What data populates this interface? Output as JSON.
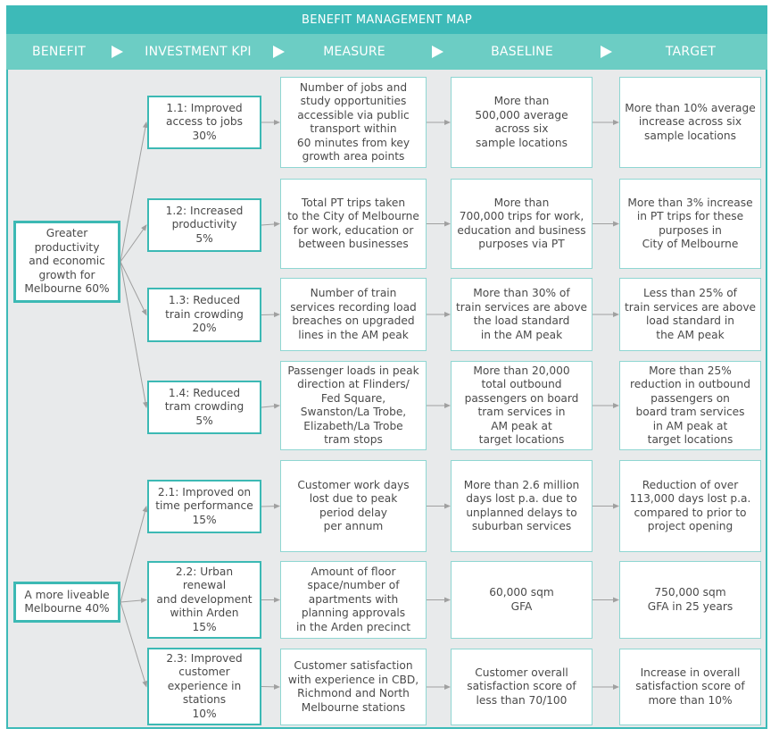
{
  "title": "BENEFIT MANAGEMENT MAP",
  "columns": [
    "BENEFIT",
    "INVESTMENT KPI",
    "MEASURE",
    "BASELINE",
    "TARGET"
  ],
  "icons": {
    "column_separator": "play-arrow-icon",
    "connector": "arrow-right-icon"
  },
  "colors": {
    "title_band": "#3dbab8",
    "header_row": "#6ccdc4",
    "body": "#e8eaeb",
    "box_border_strong": "#3cb9b4",
    "box_border_light": "#8fd6d2",
    "connector": "#a0a0a0"
  },
  "benefits": [
    {
      "id": "b1",
      "label": "Greater\nproductivity\nand economic\ngrowth for\nMelbourne 60%"
    },
    {
      "id": "b2",
      "label": "A more liveable\nMelbourne 40%"
    }
  ],
  "rows": [
    {
      "benefit": "b1",
      "kpi": "1.1: Improved\naccess to jobs\n30%",
      "measure": "Number of jobs and\nstudy opportunities\naccessible via public\ntransport within\n60 minutes from key\ngrowth area points",
      "baseline": "More than\n500,000 average\nacross six\nsample locations",
      "target": "More than 10% average\nincrease across six\nsample locations"
    },
    {
      "benefit": "b1",
      "kpi": "1.2: Increased\nproductivity\n5%",
      "measure": "Total PT trips taken\nto the City of Melbourne\nfor work, education or\nbetween businesses",
      "baseline": "More than\n700,000 trips for work,\neducation and business\npurposes via PT",
      "target": "More than 3% increase\nin PT trips for these\npurposes in\nCity of Melbourne"
    },
    {
      "benefit": "b1",
      "kpi": "1.3: Reduced\ntrain crowding\n20%",
      "measure": "Number of train\nservices recording load\nbreaches on upgraded\nlines in the AM peak",
      "baseline": "More than 30% of\ntrain services are above\nthe load standard\nin the AM peak",
      "target": "Less than 25% of\ntrain services are above\nload standard in\nthe AM peak"
    },
    {
      "benefit": "b1",
      "kpi": "1.4: Reduced\ntram crowding\n5%",
      "measure": "Passenger loads in peak\ndirection at Flinders/\nFed Square,\nSwanston/La Trobe,\nElizabeth/La Trobe\ntram stops",
      "baseline": "More than 20,000\ntotal outbound\npassengers on board\ntram services in\nAM peak at\ntarget locations",
      "target": "More than 25%\nreduction in outbound\npassengers on\nboard tram services\nin AM peak at\ntarget locations"
    },
    {
      "benefit": "b2",
      "kpi": "2.1: Improved on\ntime performance\n15%",
      "measure": "Customer work days\nlost due to peak\nperiod delay\nper annum",
      "baseline": "More than 2.6 million\ndays lost p.a. due to\nunplanned delays to\nsuburban services",
      "target": "Reduction of over\n113,000 days lost p.a.\ncompared to prior to\nproject opening"
    },
    {
      "benefit": "b2",
      "kpi": "2.2: Urban\nrenewal\nand development\nwithin Arden\n15%",
      "measure": "Amount of floor\nspace/number of\napartments with\nplanning approvals\nin the Arden precinct",
      "baseline": "60,000 sqm\nGFA",
      "target": "750,000 sqm\nGFA in 25 years"
    },
    {
      "benefit": "b2",
      "kpi": "2.3: Improved\ncustomer\nexperience in\nstations\n10%",
      "measure": "Customer satisfaction\nwith experience in CBD,\nRichmond and North\nMelbourne stations",
      "baseline": "Customer overall\nsatisfaction score of\nless than 70/100",
      "target": "Increase in overall\nsatisfaction score of\nmore than 10%"
    }
  ]
}
